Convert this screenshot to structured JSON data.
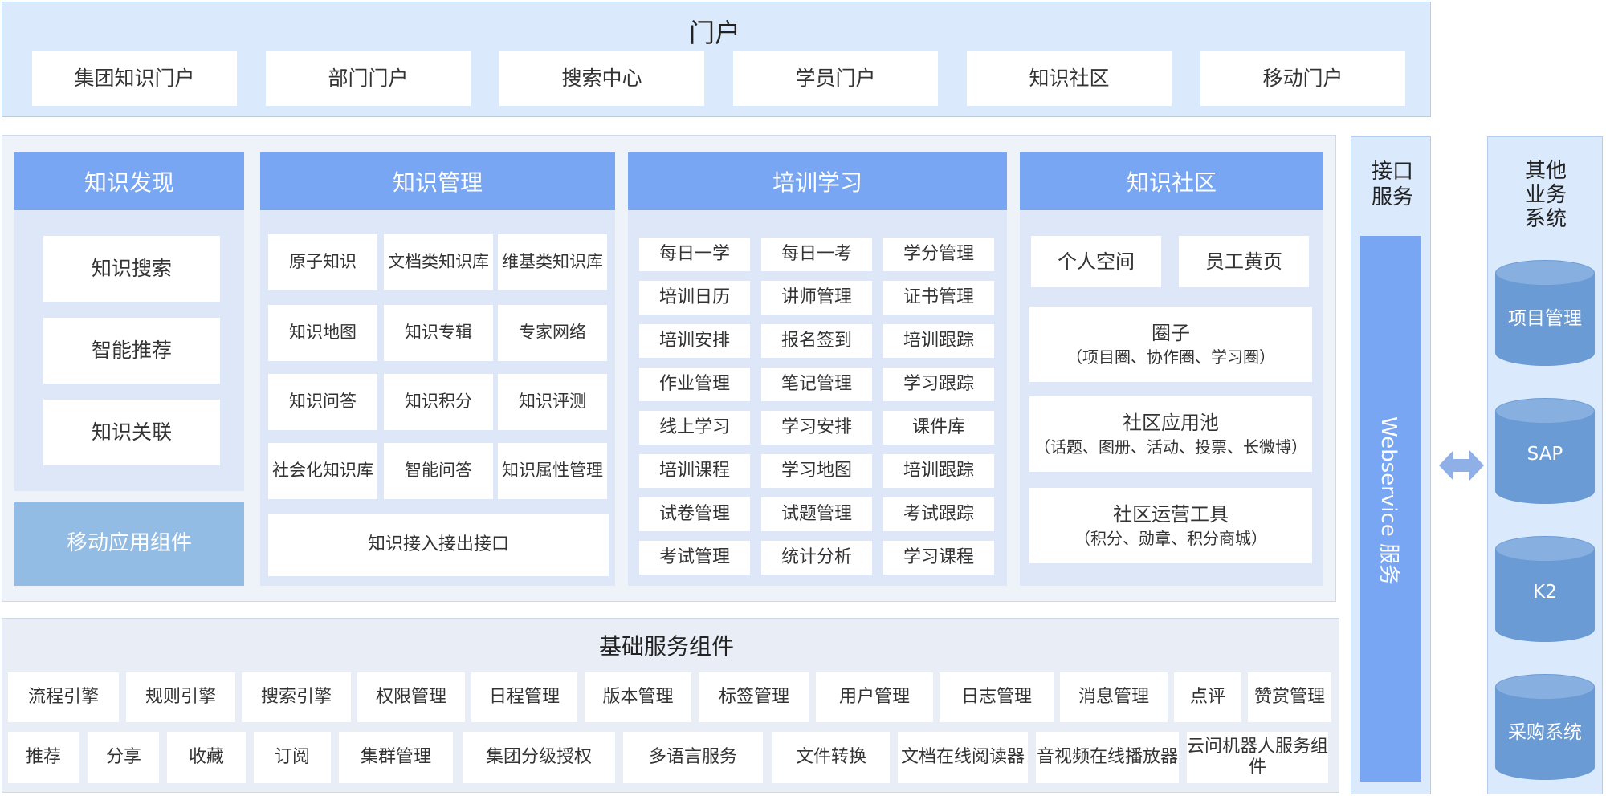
{
  "portal": {
    "title": "门户",
    "items": [
      "集团知识门户",
      "部门门户",
      "搜索中心",
      "学员门户",
      "知识社区",
      "移动门户"
    ]
  },
  "discovery": {
    "title": "知识发现",
    "items": [
      "知识搜索",
      "智能推荐",
      "知识关联"
    ],
    "mobile": "移动应用组件"
  },
  "management": {
    "title": "知识管理",
    "items": [
      "原子知识",
      "文档类知识库",
      "维基类知识库",
      "知识地图",
      "知识专辑",
      "专家网络",
      "知识问答",
      "知识积分",
      "知识评测",
      "社会化知识库",
      "智能问答",
      "知识属性管理"
    ],
    "interface": "知识接入接出接口"
  },
  "training": {
    "title": "培训学习",
    "items": [
      "每日一学",
      "每日一考",
      "学分管理",
      "培训日历",
      "讲师管理",
      "证书管理",
      "培训安排",
      "报名签到",
      "培训跟踪",
      "作业管理",
      "笔记管理",
      "学习跟踪",
      "线上学习",
      "学习安排",
      "课件库",
      "培训课程",
      "学习地图",
      "培训跟踪",
      "试卷管理",
      "试题管理",
      "考试跟踪",
      "考试管理",
      "统计分析",
      "学习课程"
    ]
  },
  "community": {
    "title": "知识社区",
    "personal_space": "个人空间",
    "yellow_pages": "员工黄页",
    "circle": "圈子",
    "circle_sub": "（项目圈、协作圈、学习圈）",
    "app_pool": "社区应用池",
    "app_pool_sub": "（话题、图册、活动、投票、长微博）",
    "ops_tools": "社区运营工具",
    "ops_tools_sub": "（积分、勋章、积分商城）"
  },
  "base": {
    "title": "基础服务组件",
    "row1": [
      "流程引擎",
      "规则引擎",
      "搜索引擎",
      "权限管理",
      "日程管理",
      "版本管理",
      "标签管理",
      "用户管理",
      "日志管理",
      "消息管理",
      "点评",
      "赞赏管理"
    ],
    "row2": [
      "推荐",
      "分享",
      "收藏",
      "订阅",
      "集群管理",
      "集团分级授权",
      "多语言服务",
      "文件转换",
      "文档在线阅读器",
      "音视频在线播放器",
      "云问机器人服务组件"
    ]
  },
  "interface_service": {
    "title": "接口服务",
    "webservice": "Webservice 服务"
  },
  "other_systems": {
    "title": "其他业务系统",
    "systems": [
      "项目管理",
      "SAP",
      "K2",
      "采购系统"
    ]
  },
  "colors": {
    "header_blue": "#79a6f2",
    "panel_light": "#dde7f8",
    "portal_bg": "#dbe9fc",
    "mobile_blue": "#93bce4",
    "cylinder": "#6b9bd4",
    "arrow": "#8fb0e6"
  }
}
